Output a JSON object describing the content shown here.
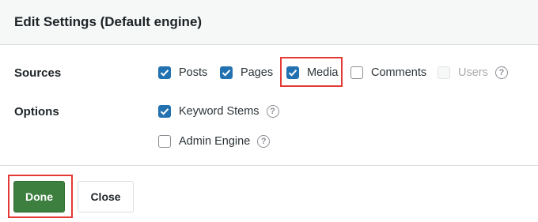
{
  "header": {
    "title": "Edit Settings (Default engine)"
  },
  "sources": {
    "label": "Sources",
    "items": [
      {
        "label": "Posts",
        "state": "checked"
      },
      {
        "label": "Pages",
        "state": "checked"
      },
      {
        "label": "Media",
        "state": "checked",
        "highlighted": true
      },
      {
        "label": "Comments",
        "state": "unchecked"
      },
      {
        "label": "Users",
        "state": "disabled",
        "help_icon": "question-circle-icon"
      }
    ]
  },
  "options": {
    "label": "Options",
    "items": [
      {
        "label": "Keyword Stems",
        "state": "checked",
        "help_icon": "question-circle-icon"
      },
      {
        "label": "Admin Engine",
        "state": "unchecked",
        "help_icon": "question-circle-icon"
      }
    ]
  },
  "footer": {
    "done_label": "Done",
    "close_label": "Close",
    "done_highlighted": true
  },
  "colors": {
    "checkbox_checked": "#2271b1",
    "done_button": "#3d7f3e",
    "highlight_outline": "#e53935",
    "header_bg": "#f6f7f7"
  }
}
